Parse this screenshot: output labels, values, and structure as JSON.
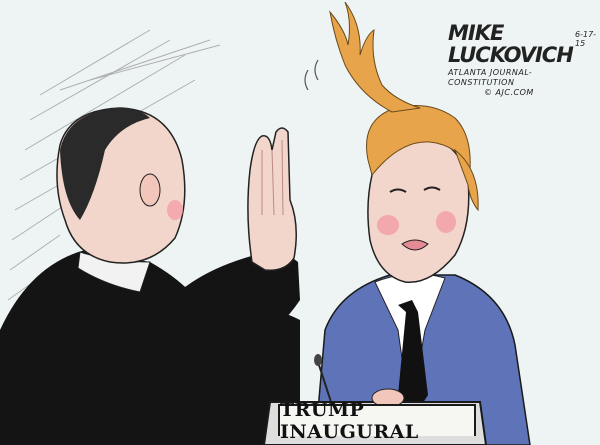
{
  "cartoon": {
    "signature": {
      "name": "MIKE LUCKOVICH",
      "date": "6-17-15",
      "newspaper": "ATLANTA JOURNAL-CONSTITUTION",
      "website": "© AJC.COM"
    },
    "podium_sign": "TRUMP INAUGURAL"
  },
  "colors": {
    "background": "#eef4f4",
    "hair": "#e8a44a",
    "suit": "#5f74b8",
    "robe": "#141414",
    "skin": "#f3d6cb",
    "blush": "#f2a0a8"
  }
}
